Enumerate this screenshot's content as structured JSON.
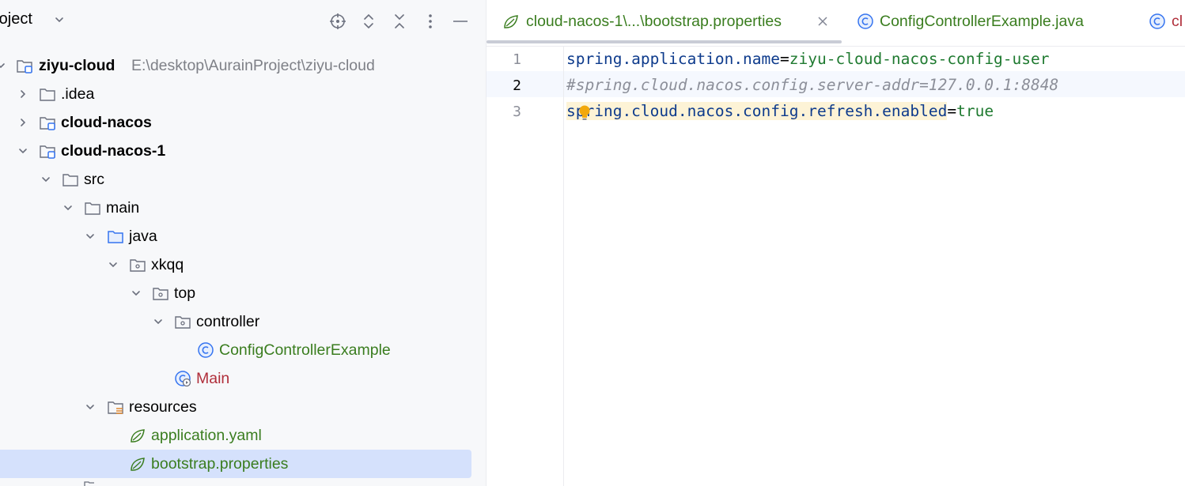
{
  "project_panel": {
    "title": "roject",
    "tree": [
      {
        "label": "ziyu-cloud",
        "path": "E:\\desktop\\AurainProject\\ziyu-cloud"
      },
      {
        "label": ".idea"
      },
      {
        "label": "cloud-nacos"
      },
      {
        "label": "cloud-nacos-1"
      },
      {
        "label": "src"
      },
      {
        "label": "main"
      },
      {
        "label": "java"
      },
      {
        "label": "xkqq"
      },
      {
        "label": "top"
      },
      {
        "label": "controller"
      },
      {
        "label": "ConfigControllerExample"
      },
      {
        "label": "Main"
      },
      {
        "label": "resources"
      },
      {
        "label": "application.yaml"
      },
      {
        "label": "bootstrap.properties"
      }
    ]
  },
  "editor": {
    "tabs": [
      {
        "label": "cloud-nacos-1\\...\\bootstrap.properties",
        "active": true
      },
      {
        "label": "ConfigControllerExample.java"
      },
      {
        "label": "cl"
      }
    ],
    "line_numbers": [
      "1",
      "2",
      "3"
    ],
    "lines": [
      {
        "key": "spring.application.name",
        "eq": "=",
        "value": "ziyu-cloud-nacos-config-user"
      },
      {
        "comment": "#spring.cloud.nacos.config.server-addr=127.0.0.1:8848"
      },
      {
        "key": "spring.cloud.nacos.config.refresh.enabled",
        "eq": "=",
        "value": "true"
      }
    ]
  },
  "colors": {
    "accent": "#3574f0",
    "selection": "#d5e1fc",
    "key": "#0e3b8c",
    "value": "#1f7a30",
    "comment": "#8c8f99",
    "red_class": "#b02e3a"
  }
}
